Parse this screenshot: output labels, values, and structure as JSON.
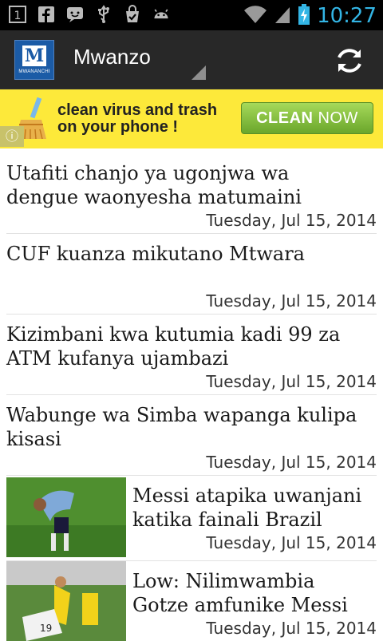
{
  "status_bar": {
    "time": "10:27",
    "left_icons": [
      "notification-1-icon",
      "facebook-icon",
      "chat-icon",
      "usb-icon",
      "download-check-icon",
      "android-icon"
    ],
    "right_icons": [
      "wifi-icon",
      "signal-icon",
      "battery-charging-icon"
    ],
    "notification_count": "1",
    "accent": "#33b5e5"
  },
  "action_bar": {
    "logo_letter": "M",
    "logo_text": "MWANANCHI",
    "title": "Mwanzo",
    "refresh_icon": "refresh-icon"
  },
  "ad": {
    "text": "clean virus and trash on your phone !",
    "button_word1": "CLEAN",
    "button_word2": "NOW",
    "info_icon": "info-icon",
    "broom_icon": "broom-icon"
  },
  "articles": [
    {
      "title": "Utafiti chanjo ya ugonjwa wa dengue waonyesha matumaini",
      "date": "Tuesday, Jul 15, 2014"
    },
    {
      "title": "CUF kuanza mikutano Mtwara",
      "date": "Tuesday, Jul 15, 2014"
    },
    {
      "title": "Kizimbani kwa kutumia kadi 99 za ATM kufanya ujambazi",
      "date": "Tuesday, Jul 15, 2014"
    },
    {
      "title": "Wabunge wa Simba wapanga kulipa kisasi",
      "date": "Tuesday, Jul 15, 2014"
    },
    {
      "title": "Messi atapika uwanjani katika fainali Brazil",
      "date": "Tuesday, Jul 15, 2014"
    },
    {
      "title": "Low: Nilimwambia Gotze amfunike Messi",
      "date": "Tuesday, Jul 15, 2014"
    }
  ]
}
